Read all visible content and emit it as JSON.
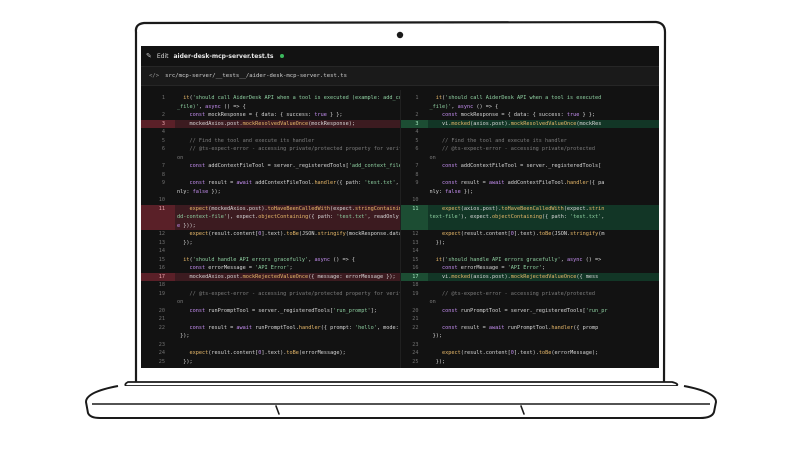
{
  "titlebar": {
    "edit_label": "Edit",
    "filename": "aider-desk-mcp-server.test.ts"
  },
  "file_path": "src/mcp-server/__tests__/aider-desk-mcp-server.test.ts",
  "left_lines": [
    {
      "n": "1",
      "t": "",
      "s": [
        {
          "k": "pl",
          "x": "  "
        },
        {
          "k": "fn",
          "x": "it"
        },
        {
          "k": "pl",
          "x": "("
        },
        {
          "k": "str",
          "x": "'should call AiderDesk API when a tool is executed (example: add_context"
        },
        {
          "k": "pl",
          "x": ""
        }
      ]
    },
    {
      "n": "",
      "t": "",
      "s": [
        {
          "k": "str",
          "x": "_file)'"
        },
        {
          "k": "pl",
          "x": ", "
        },
        {
          "k": "kw",
          "x": "async"
        },
        {
          "k": "pl",
          "x": " () => {"
        }
      ]
    },
    {
      "n": "2",
      "t": "",
      "s": [
        {
          "k": "kw",
          "x": "    const"
        },
        {
          "k": "pl",
          "x": " mockResponse = { data: { success: "
        },
        {
          "k": "kw",
          "x": "true"
        },
        {
          "k": "pl",
          "x": " } };"
        }
      ]
    },
    {
      "n": "3",
      "t": "del",
      "s": [
        {
          "k": "pl",
          "x": "    mockedAxios.post."
        },
        {
          "k": "fn",
          "x": "mockResolvedValueOnce"
        },
        {
          "k": "pl",
          "x": "(mockResponse);"
        }
      ]
    },
    {
      "n": "4",
      "t": "",
      "s": []
    },
    {
      "n": "5",
      "t": "",
      "s": [
        {
          "k": "cm",
          "x": "    // Find the tool and execute its handler"
        }
      ]
    },
    {
      "n": "6",
      "t": "",
      "s": [
        {
          "k": "cm",
          "x": "    // @ts-expect-error - accessing private/protected property for verificati"
        }
      ]
    },
    {
      "n": "",
      "t": "",
      "s": [
        {
          "k": "cm",
          "x": "on"
        }
      ]
    },
    {
      "n": "7",
      "t": "",
      "s": [
        {
          "k": "kw",
          "x": "    const"
        },
        {
          "k": "pl",
          "x": " addContextFileTool = server._registeredTools["
        },
        {
          "k": "str",
          "x": "'add_context_file'"
        },
        {
          "k": "pl",
          "x": "];"
        }
      ]
    },
    {
      "n": "8",
      "t": "",
      "s": []
    },
    {
      "n": "9",
      "t": "",
      "s": [
        {
          "k": "kw",
          "x": "    const"
        },
        {
          "k": "pl",
          "x": " result = "
        },
        {
          "k": "kw",
          "x": "await"
        },
        {
          "k": "pl",
          "x": " addContextFileTool."
        },
        {
          "k": "fn",
          "x": "handler"
        },
        {
          "k": "pl",
          "x": "({ path: "
        },
        {
          "k": "str",
          "x": "'test.txt'"
        },
        {
          "k": "pl",
          "x": ", readO"
        }
      ]
    },
    {
      "n": "",
      "t": "",
      "s": [
        {
          "k": "pl",
          "x": "nly: "
        },
        {
          "k": "kw",
          "x": "false"
        },
        {
          "k": "pl",
          "x": " });"
        }
      ]
    },
    {
      "n": "10",
      "t": "",
      "s": []
    },
    {
      "n": "11",
      "t": "del",
      "s": [
        {
          "k": "fn",
          "x": "    expect"
        },
        {
          "k": "pl",
          "x": "(mockedAxios.post)."
        },
        {
          "k": "fn",
          "x": "toHaveBeenCalledWith"
        },
        {
          "k": "pl",
          "x": "(expect."
        },
        {
          "k": "fn",
          "x": "stringContaining"
        },
        {
          "k": "pl",
          "x": "("
        },
        {
          "k": "str",
          "x": "'/a"
        }
      ]
    },
    {
      "n": "",
      "t": "del",
      "s": [
        {
          "k": "str",
          "x": "dd-context-file'"
        },
        {
          "k": "pl",
          "x": "), expect."
        },
        {
          "k": "fn",
          "x": "objectContaining"
        },
        {
          "k": "pl",
          "x": "({ path: "
        },
        {
          "k": "str",
          "x": "'test.txt'"
        },
        {
          "k": "pl",
          "x": ", readOnly: "
        },
        {
          "k": "kw",
          "x": "fals"
        }
      ]
    },
    {
      "n": "",
      "t": "del",
      "s": [
        {
          "k": "kw",
          "x": "e"
        },
        {
          "k": "pl",
          "x": " }));"
        }
      ]
    },
    {
      "n": "12",
      "t": "",
      "s": [
        {
          "k": "fn",
          "x": "    expect"
        },
        {
          "k": "pl",
          "x": "(result.content["
        },
        {
          "k": "kw",
          "x": "0"
        },
        {
          "k": "pl",
          "x": "].text)."
        },
        {
          "k": "fn",
          "x": "toBe"
        },
        {
          "k": "pl",
          "x": "(JSON."
        },
        {
          "k": "fn",
          "x": "stringify"
        },
        {
          "k": "pl",
          "x": "(mockResponse.data));"
        }
      ]
    },
    {
      "n": "13",
      "t": "",
      "s": [
        {
          "k": "pl",
          "x": "  });"
        }
      ]
    },
    {
      "n": "14",
      "t": "",
      "s": []
    },
    {
      "n": "15",
      "t": "",
      "s": [
        {
          "k": "pl",
          "x": "  "
        },
        {
          "k": "fn",
          "x": "it"
        },
        {
          "k": "pl",
          "x": "("
        },
        {
          "k": "str",
          "x": "'should handle API errors gracefully'"
        },
        {
          "k": "pl",
          "x": ", "
        },
        {
          "k": "kw",
          "x": "async"
        },
        {
          "k": "pl",
          "x": " () => {"
        }
      ]
    },
    {
      "n": "16",
      "t": "",
      "s": [
        {
          "k": "kw",
          "x": "    const"
        },
        {
          "k": "pl",
          "x": " errorMessage = "
        },
        {
          "k": "str",
          "x": "'API Error'"
        },
        {
          "k": "pl",
          "x": ";"
        }
      ]
    },
    {
      "n": "17",
      "t": "del",
      "s": [
        {
          "k": "pl",
          "x": "    mockedAxios.post."
        },
        {
          "k": "fn",
          "x": "mockRejectedValueOnce"
        },
        {
          "k": "pl",
          "x": "({ message: errorMessage });"
        }
      ]
    },
    {
      "n": "18",
      "t": "",
      "s": []
    },
    {
      "n": "19",
      "t": "",
      "s": [
        {
          "k": "cm",
          "x": "    // @ts-expect-error - accessing private/protected property for verificati"
        }
      ]
    },
    {
      "n": "",
      "t": "",
      "s": [
        {
          "k": "cm",
          "x": "on"
        }
      ]
    },
    {
      "n": "20",
      "t": "",
      "s": [
        {
          "k": "kw",
          "x": "    const"
        },
        {
          "k": "pl",
          "x": " runPromptTool = server._registeredTools["
        },
        {
          "k": "str",
          "x": "'run_prompt'"
        },
        {
          "k": "pl",
          "x": "];"
        }
      ]
    },
    {
      "n": "21",
      "t": "",
      "s": []
    },
    {
      "n": "22",
      "t": "",
      "s": [
        {
          "k": "kw",
          "x": "    const"
        },
        {
          "k": "pl",
          "x": " result = "
        },
        {
          "k": "kw",
          "x": "await"
        },
        {
          "k": "pl",
          "x": " runPromptTool."
        },
        {
          "k": "fn",
          "x": "handler"
        },
        {
          "k": "pl",
          "x": "({ prompt: "
        },
        {
          "k": "str",
          "x": "'hello'"
        },
        {
          "k": "pl",
          "x": ", mode: "
        },
        {
          "k": "str",
          "x": "'ask'"
        }
      ]
    },
    {
      "n": "",
      "t": "",
      "s": [
        {
          "k": "pl",
          "x": " });"
        }
      ]
    },
    {
      "n": "23",
      "t": "",
      "s": []
    },
    {
      "n": "24",
      "t": "",
      "s": [
        {
          "k": "fn",
          "x": "    expect"
        },
        {
          "k": "pl",
          "x": "(result.content["
        },
        {
          "k": "kw",
          "x": "0"
        },
        {
          "k": "pl",
          "x": "].text)."
        },
        {
          "k": "fn",
          "x": "toBe"
        },
        {
          "k": "pl",
          "x": "(errorMessage);"
        }
      ]
    },
    {
      "n": "25",
      "t": "",
      "s": [
        {
          "k": "pl",
          "x": "  });"
        }
      ]
    }
  ],
  "right_lines": [
    {
      "n": "1",
      "t": "",
      "s": [
        {
          "k": "pl",
          "x": "  "
        },
        {
          "k": "fn",
          "x": "it"
        },
        {
          "k": "pl",
          "x": "("
        },
        {
          "k": "str",
          "x": "'should call AiderDesk API when a tool is executed"
        }
      ]
    },
    {
      "n": "",
      "t": "",
      "s": [
        {
          "k": "str",
          "x": "_file)'"
        },
        {
          "k": "pl",
          "x": ", "
        },
        {
          "k": "kw",
          "x": "async"
        },
        {
          "k": "pl",
          "x": " () => {"
        }
      ]
    },
    {
      "n": "2",
      "t": "",
      "s": [
        {
          "k": "kw",
          "x": "    const"
        },
        {
          "k": "pl",
          "x": " mockResponse = { data: { success: "
        },
        {
          "k": "kw",
          "x": "true"
        },
        {
          "k": "pl",
          "x": " } };"
        }
      ]
    },
    {
      "n": "3",
      "t": "add",
      "s": [
        {
          "k": "pl",
          "x": "    vi."
        },
        {
          "k": "fn",
          "x": "mocked"
        },
        {
          "k": "pl",
          "x": "(axios.post)."
        },
        {
          "k": "fn",
          "x": "mockResolvedValueOnce"
        },
        {
          "k": "pl",
          "x": "(mockRes"
        }
      ]
    },
    {
      "n": "4",
      "t": "",
      "s": []
    },
    {
      "n": "5",
      "t": "",
      "s": [
        {
          "k": "cm",
          "x": "    // Find the tool and execute its handler"
        }
      ]
    },
    {
      "n": "6",
      "t": "",
      "s": [
        {
          "k": "cm",
          "x": "    // @ts-expect-error - accessing private/protected"
        }
      ]
    },
    {
      "n": "",
      "t": "",
      "s": [
        {
          "k": "cm",
          "x": "on"
        }
      ]
    },
    {
      "n": "7",
      "t": "",
      "s": [
        {
          "k": "kw",
          "x": "    const"
        },
        {
          "k": "pl",
          "x": " addContextFileTool = server._registeredTools["
        }
      ]
    },
    {
      "n": "8",
      "t": "",
      "s": []
    },
    {
      "n": "9",
      "t": "",
      "s": [
        {
          "k": "kw",
          "x": "    const"
        },
        {
          "k": "pl",
          "x": " result = "
        },
        {
          "k": "kw",
          "x": "await"
        },
        {
          "k": "pl",
          "x": " addContextFileTool."
        },
        {
          "k": "fn",
          "x": "handler"
        },
        {
          "k": "pl",
          "x": "({ pa"
        }
      ]
    },
    {
      "n": "",
      "t": "",
      "s": [
        {
          "k": "pl",
          "x": "nly: "
        },
        {
          "k": "kw",
          "x": "false"
        },
        {
          "k": "pl",
          "x": " });"
        }
      ]
    },
    {
      "n": "10",
      "t": "",
      "s": []
    },
    {
      "n": "11",
      "t": "add",
      "s": [
        {
          "k": "fn",
          "x": "    expect"
        },
        {
          "k": "pl",
          "x": "(axios.post)."
        },
        {
          "k": "fn",
          "x": "toHaveBeenCalledWith"
        },
        {
          "k": "pl",
          "x": "(expect."
        },
        {
          "k": "fn",
          "x": "strin"
        }
      ]
    },
    {
      "n": "",
      "t": "add",
      "s": [
        {
          "k": "str",
          "x": "text-file'"
        },
        {
          "k": "pl",
          "x": "), expect."
        },
        {
          "k": "fn",
          "x": "objectContaining"
        },
        {
          "k": "pl",
          "x": "({ path: "
        },
        {
          "k": "str",
          "x": "'test.txt'"
        },
        {
          "k": "pl",
          "x": ","
        }
      ]
    },
    {
      "n": "",
      "t": "add",
      "s": []
    },
    {
      "n": "12",
      "t": "",
      "s": [
        {
          "k": "fn",
          "x": "    expect"
        },
        {
          "k": "pl",
          "x": "(result.content["
        },
        {
          "k": "kw",
          "x": "0"
        },
        {
          "k": "pl",
          "x": "].text)."
        },
        {
          "k": "fn",
          "x": "toBe"
        },
        {
          "k": "pl",
          "x": "(JSON."
        },
        {
          "k": "fn",
          "x": "stringify"
        },
        {
          "k": "pl",
          "x": "(m"
        }
      ]
    },
    {
      "n": "13",
      "t": "",
      "s": [
        {
          "k": "pl",
          "x": "  });"
        }
      ]
    },
    {
      "n": "14",
      "t": "",
      "s": []
    },
    {
      "n": "15",
      "t": "",
      "s": [
        {
          "k": "pl",
          "x": "  "
        },
        {
          "k": "fn",
          "x": "it"
        },
        {
          "k": "pl",
          "x": "("
        },
        {
          "k": "str",
          "x": "'should handle API errors gracefully'"
        },
        {
          "k": "pl",
          "x": ", "
        },
        {
          "k": "kw",
          "x": "async"
        },
        {
          "k": "pl",
          "x": " () =>"
        }
      ]
    },
    {
      "n": "16",
      "t": "",
      "s": [
        {
          "k": "kw",
          "x": "    const"
        },
        {
          "k": "pl",
          "x": " errorMessage = "
        },
        {
          "k": "str",
          "x": "'API Error'"
        },
        {
          "k": "pl",
          "x": ";"
        }
      ]
    },
    {
      "n": "17",
      "t": "add",
      "s": [
        {
          "k": "pl",
          "x": "    vi."
        },
        {
          "k": "fn",
          "x": "mocked"
        },
        {
          "k": "pl",
          "x": "(axios.post)."
        },
        {
          "k": "fn",
          "x": "mockRejectedValueOnce"
        },
        {
          "k": "pl",
          "x": "({ mess"
        }
      ]
    },
    {
      "n": "18",
      "t": "",
      "s": []
    },
    {
      "n": "19",
      "t": "",
      "s": [
        {
          "k": "cm",
          "x": "    // @ts-expect-error - accessing private/protected"
        }
      ]
    },
    {
      "n": "",
      "t": "",
      "s": [
        {
          "k": "cm",
          "x": "on"
        }
      ]
    },
    {
      "n": "20",
      "t": "",
      "s": [
        {
          "k": "kw",
          "x": "    const"
        },
        {
          "k": "pl",
          "x": " runPromptTool = server._registeredTools["
        },
        {
          "k": "str",
          "x": "'run_pr"
        }
      ]
    },
    {
      "n": "21",
      "t": "",
      "s": []
    },
    {
      "n": "22",
      "t": "",
      "s": [
        {
          "k": "kw",
          "x": "    const"
        },
        {
          "k": "pl",
          "x": " result = "
        },
        {
          "k": "kw",
          "x": "await"
        },
        {
          "k": "pl",
          "x": " runPromptTool."
        },
        {
          "k": "fn",
          "x": "handler"
        },
        {
          "k": "pl",
          "x": "({ promp"
        }
      ]
    },
    {
      "n": "",
      "t": "",
      "s": [
        {
          "k": "pl",
          "x": " });"
        }
      ]
    },
    {
      "n": "23",
      "t": "",
      "s": []
    },
    {
      "n": "24",
      "t": "",
      "s": [
        {
          "k": "fn",
          "x": "    expect"
        },
        {
          "k": "pl",
          "x": "(result.content["
        },
        {
          "k": "kw",
          "x": "0"
        },
        {
          "k": "pl",
          "x": "].text)."
        },
        {
          "k": "fn",
          "x": "toBe"
        },
        {
          "k": "pl",
          "x": "(errorMessage);"
        }
      ]
    },
    {
      "n": "25",
      "t": "",
      "s": [
        {
          "k": "pl",
          "x": "  });"
        }
      ]
    }
  ]
}
